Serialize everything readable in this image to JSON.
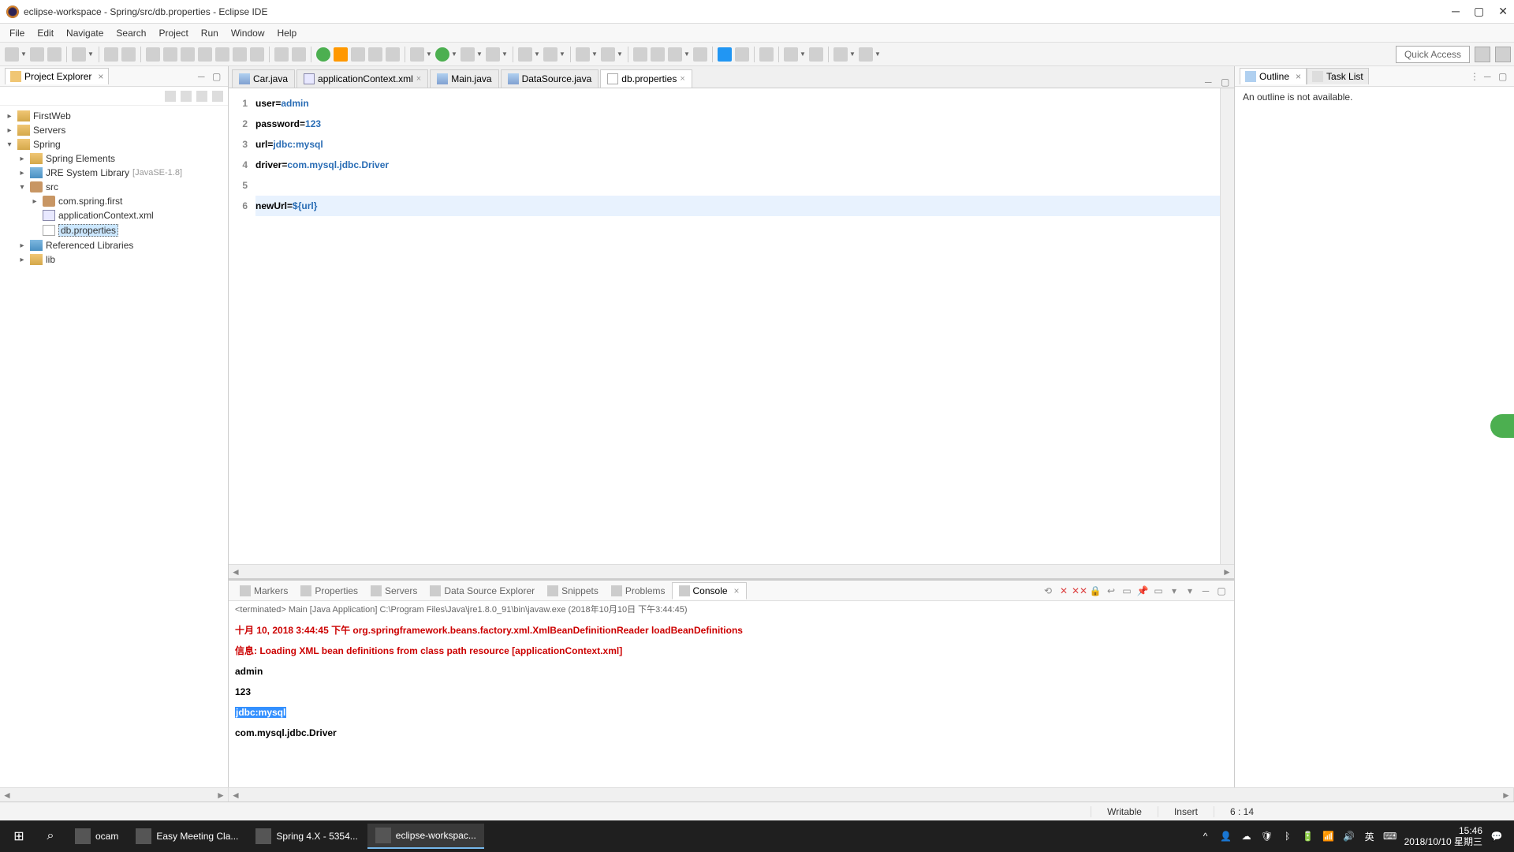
{
  "window": {
    "title": "eclipse-workspace - Spring/src/db.properties - Eclipse IDE"
  },
  "menubar": [
    "File",
    "Edit",
    "Navigate",
    "Search",
    "Project",
    "Run",
    "Window",
    "Help"
  ],
  "quick_access": "Quick Access",
  "left_panel": {
    "title": "Project Explorer",
    "tree": [
      {
        "level": 0,
        "expanded": false,
        "icon": "project",
        "label": "FirstWeb"
      },
      {
        "level": 0,
        "expanded": false,
        "icon": "project",
        "label": "Servers"
      },
      {
        "level": 0,
        "expanded": true,
        "icon": "project",
        "label": "Spring"
      },
      {
        "level": 1,
        "expanded": false,
        "icon": "folder",
        "label": "Spring Elements"
      },
      {
        "level": 1,
        "expanded": false,
        "icon": "library",
        "label": "JRE System Library",
        "decorator": "[JavaSE-1.8]"
      },
      {
        "level": 1,
        "expanded": true,
        "icon": "package",
        "label": "src"
      },
      {
        "level": 2,
        "expanded": false,
        "icon": "package",
        "label": "com.spring.first"
      },
      {
        "level": 2,
        "expanded": null,
        "icon": "xml",
        "label": "applicationContext.xml"
      },
      {
        "level": 2,
        "expanded": null,
        "icon": "file",
        "label": "db.properties",
        "selected": true
      },
      {
        "level": 1,
        "expanded": false,
        "icon": "library",
        "label": "Referenced Libraries"
      },
      {
        "level": 1,
        "expanded": false,
        "icon": "folder",
        "label": "lib"
      }
    ]
  },
  "editor": {
    "tabs": [
      {
        "icon": "java-file",
        "label": "Car.java",
        "active": false,
        "closable": false
      },
      {
        "icon": "xml",
        "label": "applicationContext.xml",
        "active": false,
        "closable": true
      },
      {
        "icon": "java-file",
        "label": "Main.java",
        "active": false,
        "closable": false
      },
      {
        "icon": "java-file",
        "label": "DataSource.java",
        "active": false,
        "closable": false
      },
      {
        "icon": "file",
        "label": "db.properties",
        "active": true,
        "closable": true
      }
    ],
    "lines": [
      {
        "n": 1,
        "segments": [
          {
            "t": "user=",
            "c": "key"
          },
          {
            "t": "admin",
            "c": "val"
          }
        ]
      },
      {
        "n": 2,
        "segments": [
          {
            "t": "password=",
            "c": "key"
          },
          {
            "t": "123",
            "c": "val"
          }
        ]
      },
      {
        "n": 3,
        "segments": [
          {
            "t": "url=",
            "c": "key"
          },
          {
            "t": "jdbc:mysql",
            "c": "val"
          }
        ]
      },
      {
        "n": 4,
        "segments": [
          {
            "t": "driver=",
            "c": "key"
          },
          {
            "t": "com.mysql.jdbc.Driver",
            "c": "val"
          }
        ]
      },
      {
        "n": 5,
        "segments": []
      },
      {
        "n": 6,
        "current": true,
        "segments": [
          {
            "t": "newUrl=",
            "c": "key"
          },
          {
            "t": "${url}",
            "c": "expr"
          }
        ]
      }
    ]
  },
  "right_panel": {
    "tabs": [
      {
        "label": "Outline",
        "active": true
      },
      {
        "label": "Task List",
        "active": false
      }
    ],
    "message": "An outline is not available."
  },
  "bottom_panel": {
    "tabs": [
      {
        "label": "Markers"
      },
      {
        "label": "Properties"
      },
      {
        "label": "Servers"
      },
      {
        "label": "Data Source Explorer"
      },
      {
        "label": "Snippets"
      },
      {
        "label": "Problems"
      },
      {
        "label": "Console",
        "active": true
      }
    ],
    "info": "<terminated> Main [Java Application] C:\\Program Files\\Java\\jre1.8.0_91\\bin\\javaw.exe (2018年10月10日 下午3:44:45)",
    "output": [
      {
        "segments": [
          {
            "t": "十月 10, 2018 3:44:45 下午 ",
            "c": "red"
          },
          {
            "t": "org.springframework.beans.factory.xml.XmlBeanDefinitionReader loadBeanDefinitions",
            "c": "red"
          }
        ]
      },
      {
        "segments": [
          {
            "t": "信息: ",
            "c": "red"
          },
          {
            "t": "Loading XML bean definitions from class path resource [applicationContext.xml]",
            "c": "red"
          }
        ]
      },
      {
        "segments": [
          {
            "t": "admin",
            "c": "black"
          }
        ]
      },
      {
        "segments": [
          {
            "t": "123",
            "c": "black"
          }
        ]
      },
      {
        "segments": [
          {
            "t": "jdbc:mysql",
            "c": "sel"
          }
        ]
      },
      {
        "segments": [
          {
            "t": "com.mysql.jdbc.Driver",
            "c": "black"
          }
        ]
      }
    ]
  },
  "statusbar": {
    "writable": "Writable",
    "insert": "Insert",
    "position": "6 : 14"
  },
  "taskbar": {
    "items": [
      {
        "label": "ocam",
        "active": false
      },
      {
        "label": "Easy Meeting Cla...",
        "active": false
      },
      {
        "label": "Spring 4.X - 5354...",
        "active": false
      },
      {
        "label": "eclipse-workspac...",
        "active": true
      }
    ],
    "time": "15:46",
    "date": "2018/10/10 星期三"
  }
}
